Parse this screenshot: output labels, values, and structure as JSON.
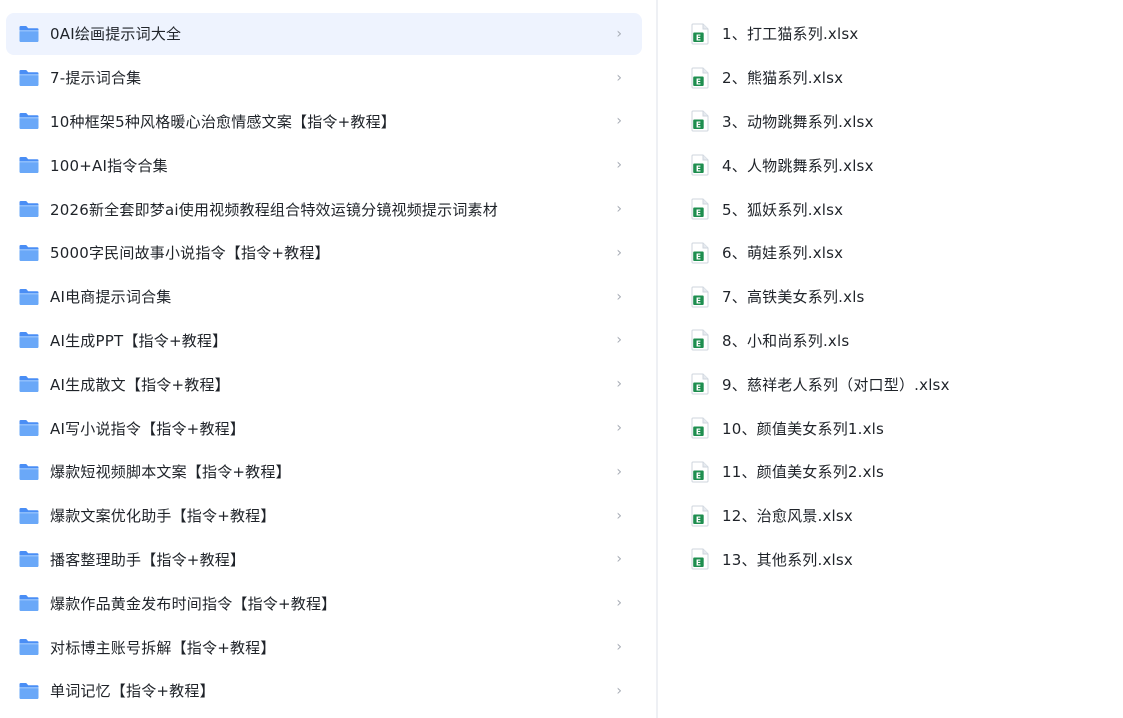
{
  "colors": {
    "selected_bg": "#eef3fe",
    "folder_blue": "#5b9cf6",
    "excel_green": "#1e8e4f",
    "chevron": "#a8adb6"
  },
  "folders": [
    {
      "label": "0AI绘画提示词大全",
      "selected": true,
      "icon": "folder-icon"
    },
    {
      "label": "7-提示词合集",
      "selected": false,
      "icon": "folder-icon"
    },
    {
      "label": "10种框架5种风格暖心治愈情感文案【指令+教程】",
      "selected": false,
      "icon": "folder-icon"
    },
    {
      "label": "100+AI指令合集",
      "selected": false,
      "icon": "folder-icon"
    },
    {
      "label": "2026新全套即梦ai使用视频教程组合特效运镜分镜视频提示词素材",
      "selected": false,
      "icon": "folder-icon"
    },
    {
      "label": "5000字民间故事小说指令【指令+教程】",
      "selected": false,
      "icon": "folder-icon"
    },
    {
      "label": "AI电商提示词合集",
      "selected": false,
      "icon": "folder-icon"
    },
    {
      "label": "AI生成PPT【指令+教程】",
      "selected": false,
      "icon": "folder-icon"
    },
    {
      "label": "AI生成散文【指令+教程】",
      "selected": false,
      "icon": "folder-icon"
    },
    {
      "label": "AI写小说指令【指令+教程】",
      "selected": false,
      "icon": "folder-icon"
    },
    {
      "label": "爆款短视频脚本文案【指令+教程】",
      "selected": false,
      "icon": "folder-icon"
    },
    {
      "label": "爆款文案优化助手【指令+教程】",
      "selected": false,
      "icon": "folder-icon"
    },
    {
      "label": "播客整理助手【指令+教程】",
      "selected": false,
      "icon": "folder-icon"
    },
    {
      "label": "爆款作品黄金发布时间指令【指令+教程】",
      "selected": false,
      "icon": "folder-icon"
    },
    {
      "label": "对标博主账号拆解【指令+教程】",
      "selected": false,
      "icon": "folder-icon"
    },
    {
      "label": "单词记忆【指令+教程】",
      "selected": false,
      "icon": "folder-icon"
    }
  ],
  "files": [
    {
      "label": "1、打工猫系列.xlsx",
      "icon": "excel-file-icon"
    },
    {
      "label": "2、熊猫系列.xlsx",
      "icon": "excel-file-icon"
    },
    {
      "label": "3、动物跳舞系列.xlsx",
      "icon": "excel-file-icon"
    },
    {
      "label": "4、人物跳舞系列.xlsx",
      "icon": "excel-file-icon"
    },
    {
      "label": "5、狐妖系列.xlsx",
      "icon": "excel-file-icon"
    },
    {
      "label": "6、萌娃系列.xlsx",
      "icon": "excel-file-icon"
    },
    {
      "label": "7、高铁美女系列.xls",
      "icon": "excel-file-icon"
    },
    {
      "label": "8、小和尚系列.xls",
      "icon": "excel-file-icon"
    },
    {
      "label": "9、慈祥老人系列（对口型）.xlsx",
      "icon": "excel-file-icon"
    },
    {
      "label": "10、颜值美女系列1.xls",
      "icon": "excel-file-icon"
    },
    {
      "label": "11、颜值美女系列2.xls",
      "icon": "excel-file-icon"
    },
    {
      "label": "12、治愈风景.xlsx",
      "icon": "excel-file-icon"
    },
    {
      "label": "13、其他系列.xlsx",
      "icon": "excel-file-icon"
    }
  ],
  "chevron_glyph": "›"
}
